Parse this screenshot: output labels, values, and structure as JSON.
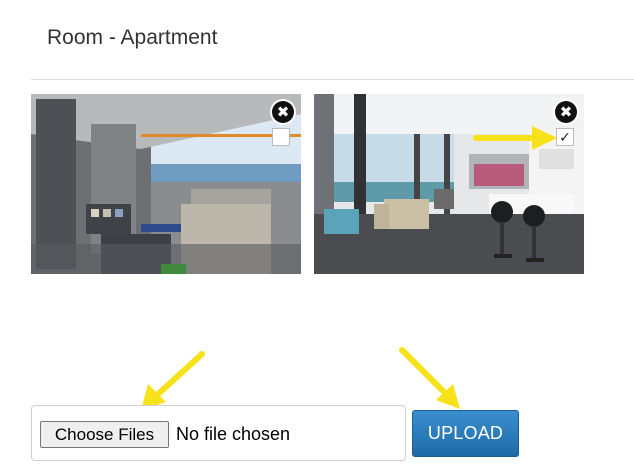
{
  "page": {
    "title": "Room - Apartment"
  },
  "images": [
    {
      "description_name": "balcony-photo",
      "selected": false
    },
    {
      "description_name": "living-room-photo",
      "selected": true
    }
  ],
  "controls": {
    "delete_icon": "✖",
    "checked_mark": "✓",
    "unchecked_mark": ""
  },
  "upload": {
    "choose_label": "Choose Files",
    "status": "No file chosen",
    "button_label": "UPLOAD"
  },
  "colors": {
    "accent_button": "#2a7bbd",
    "annotation_arrow": "#f7e21a"
  }
}
